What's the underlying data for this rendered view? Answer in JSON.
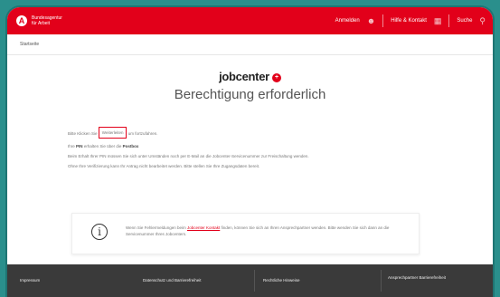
{
  "header": {
    "logo_text_1": "Bundesagentur",
    "logo_text_2": "für Arbeit",
    "nav": [
      {
        "label": "Anmelden",
        "icon": "user-icon"
      },
      {
        "label": "Hilfe & Kontakt",
        "icon": "grid-icon"
      },
      {
        "label": "Suche",
        "icon": "search-icon"
      }
    ]
  },
  "breadcrumb": "Startseite",
  "brand": "jobcenter",
  "title": "Berechtigung erforderlich",
  "content": {
    "p1_before": "Bitte Klicken Sie",
    "p1_highlight": "Weiterleiten",
    "p1_after": "um fortzufahren.",
    "p2_before": "Ihre",
    "p2_bold1": "PIN",
    "p2_middle": "erhalten Sie über die",
    "p2_bold2": "Postbox",
    "p3": "Beim Erhalt Ihrer PIN müssen Sie sich unter Umständen noch per E-Mail an die Jobcenter-Servicenummer zur Freischaltung wenden.",
    "p4": "Ohne Ihre Verifizierung kann Ihr Antrag nicht bearbeitet werden. Bitte stellen Sie Ihre Zugangsdaten bereit."
  },
  "info": {
    "text_before": "Wenn Sie Fehlermeldungen beim",
    "link": "Jobcenter Kontakt",
    "text_after": "finden, können Sie sich an Ihren Ansprechpartner wenden. Bitte wenden Sie sich dann an die Servicenummer Ihres Jobcenters."
  },
  "footer": {
    "items": [
      "Impressum",
      "Datenschutz und Barrierefreiheit",
      "Rechtliche Hinweise",
      "Ansprechpartner Barrierefreiheit"
    ]
  },
  "colors": {
    "brand_red": "#e2001a",
    "frame_teal": "#2a8f8c",
    "footer": "#3a3a3a"
  }
}
